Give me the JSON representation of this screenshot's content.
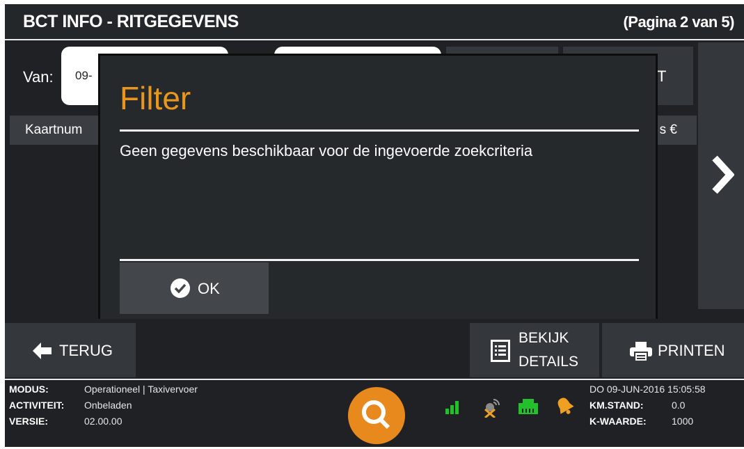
{
  "header": {
    "title": "BCT INFO - RITGEGEVENS",
    "page_indicator": "(Pagina 2 van 5)"
  },
  "filter_row": {
    "van_label": "Van:",
    "date_from_partial": "09-",
    "button_partial": "T"
  },
  "table_header": {
    "left_partial": "Kaartnum",
    "right_partial": "s €"
  },
  "dialog": {
    "title": "Filter",
    "message": "Geen gegevens beschikbaar voor de ingevoerde zoekcriteria",
    "ok_label": "OK"
  },
  "actions": {
    "back_label": "TERUG",
    "details_line1": "BEKIJK",
    "details_line2": "DETAILS",
    "print_label": "PRINTEN"
  },
  "status": {
    "modus_key": "MODUS:",
    "modus_value": "Operationeel | Taxivervoer",
    "activiteit_key": "ACTIVITEIT:",
    "activiteit_value": "Onbeladen",
    "versie_key": "VERSIE:",
    "versie_value": "02.00.00",
    "datetime": "DO 09-JUN-2016 15:05:58",
    "km_key": "KM.STAND:",
    "km_value": "0.0",
    "k_key": "K-WAARDE:",
    "k_value": "1000"
  },
  "colors": {
    "accent_orange": "#e8961e",
    "status_green": "#22c02a",
    "alert_orange": "#f0a020"
  },
  "icons": [
    "arrow-right-icon",
    "check-circle-icon",
    "arrow-left-icon",
    "list-icon",
    "printer-icon",
    "signal-icon",
    "satellite-icon",
    "network-icon",
    "bell-icon",
    "logo-icon"
  ]
}
